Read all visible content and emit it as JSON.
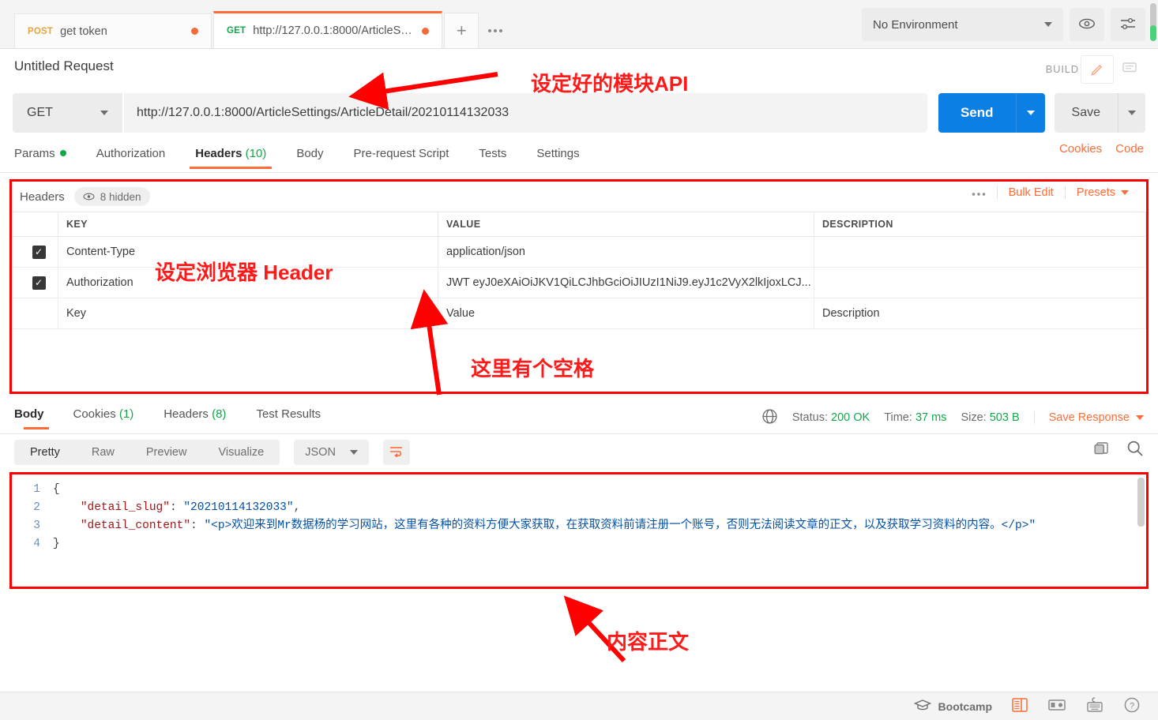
{
  "window": {
    "tabs": [
      {
        "method": "POST",
        "name": "get token",
        "unsaved": true,
        "active": false
      },
      {
        "method": "GET",
        "name": "http://127.0.0.1:8000/ArticleSet...",
        "unsaved": true,
        "active": true
      }
    ],
    "new_tab_label": "+",
    "tab_more_label": "●●●",
    "environment": {
      "selected": "No Environment"
    },
    "eye_icon": "eye-icon",
    "settings_icon": "sliders-icon"
  },
  "request": {
    "title": "Untitled Request",
    "build_label": "BUILD",
    "method": "GET",
    "url": "http://127.0.0.1:8000/ArticleSettings/ArticleDetail/20210114132033",
    "send_label": "Send",
    "save_label": "Save",
    "tabs": [
      {
        "label": "Params",
        "dot": true
      },
      {
        "label": "Authorization"
      },
      {
        "label": "Headers",
        "count": "(10)",
        "active": true
      },
      {
        "label": "Body"
      },
      {
        "label": "Pre-request Script"
      },
      {
        "label": "Tests"
      },
      {
        "label": "Settings"
      }
    ],
    "links": [
      "Cookies",
      "Code"
    ]
  },
  "headers_panel": {
    "label": "Headers",
    "hidden_label": "8 hidden",
    "more_label": "●●●",
    "bulk_edit_label": "Bulk Edit",
    "presets_label": "Presets",
    "columns": [
      "KEY",
      "VALUE",
      "DESCRIPTION"
    ],
    "rows": [
      {
        "checked": true,
        "key": "Content-Type",
        "value": "application/json",
        "description": ""
      },
      {
        "checked": true,
        "key": "Authorization",
        "value": "JWT eyJ0eXAiOiJKV1QiLCJhbGciOiJIUzI1NiJ9.eyJ1c2VyX2lkIjoxLCJ...",
        "description": ""
      },
      {
        "checked": false,
        "key": "Key",
        "value": "Value",
        "description": "Description",
        "placeholder": true
      }
    ]
  },
  "response": {
    "tabs": [
      {
        "label": "Body",
        "active": true
      },
      {
        "label": "Cookies",
        "count": "(1)"
      },
      {
        "label": "Headers",
        "count": "(8)"
      },
      {
        "label": "Test Results"
      }
    ],
    "status_label": "Status:",
    "status_value": "200 OK",
    "time_label": "Time:",
    "time_value": "37 ms",
    "size_label": "Size:",
    "size_value": "503 B",
    "save_response_label": "Save Response",
    "globe_icon": "globe-icon",
    "format_tabs": [
      {
        "label": "Pretty",
        "active": true
      },
      {
        "label": "Raw"
      },
      {
        "label": "Preview"
      },
      {
        "label": "Visualize"
      }
    ],
    "body_type": "JSON",
    "wrap_icon": "word-wrap-icon",
    "copy_icon": "copy-icon",
    "search_icon": "search-icon",
    "body_lines": [
      {
        "n": "1",
        "tokens": [
          {
            "t": "{",
            "c": "p"
          }
        ]
      },
      {
        "n": "2",
        "tokens": [
          {
            "t": "    ",
            "c": "p"
          },
          {
            "t": "\"detail_slug\"",
            "c": "k"
          },
          {
            "t": ": ",
            "c": "p"
          },
          {
            "t": "\"20210114132033\"",
            "c": "s"
          },
          {
            "t": ",",
            "c": "p"
          }
        ]
      },
      {
        "n": "3",
        "tokens": [
          {
            "t": "    ",
            "c": "p"
          },
          {
            "t": "\"detail_content\"",
            "c": "k"
          },
          {
            "t": ": ",
            "c": "p"
          },
          {
            "t": "\"<p>欢迎来到Mr数据杨的学习网站，这里有各种的资料方便大家获取，在获取资料前请注册一个账号，否则无法阅读文章的正文，以及获取学习资料的内容。</p>\"",
            "c": "s"
          }
        ]
      },
      {
        "n": "4",
        "tokens": [
          {
            "t": "}",
            "c": "p"
          }
        ]
      }
    ]
  },
  "bottom_bar": {
    "bootcamp_label": "Bootcamp",
    "icons": [
      "graduation-cap-icon",
      "two-pane-icon",
      "split-pane-icon",
      "keyboard-shortcuts-icon",
      "help-icon"
    ]
  },
  "annotations": [
    {
      "id": "a1",
      "text": "设定好的模块API"
    },
    {
      "id": "a2",
      "text": "设定浏览器 Header"
    },
    {
      "id": "a3",
      "text": "这里有个空格"
    },
    {
      "id": "a4",
      "text": "内容正文"
    }
  ],
  "colors": {
    "accent": "#ff6c37",
    "send": "#0b7fe3",
    "success": "#11a849",
    "annotation": "#ff0000"
  }
}
